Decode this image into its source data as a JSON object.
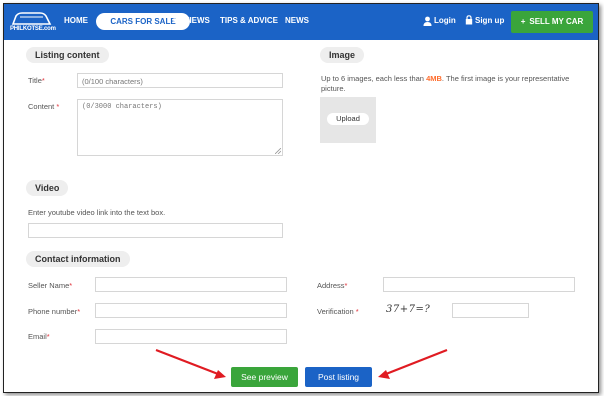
{
  "nav": {
    "logo_text": "PHILKOTSE.com",
    "links": [
      "HOME",
      "CARS FOR SALE",
      "REVIEWS",
      "TIPS & ADVICE",
      "NEWS"
    ],
    "login": "Login",
    "signup": "Sign up",
    "sell": "SELL MY CAR"
  },
  "listing": {
    "heading": "Listing content",
    "title_label": "Title",
    "title_placeholder": "(0/100 characters)",
    "content_label": "Content",
    "content_placeholder": "(0/3000 characters)"
  },
  "image": {
    "heading": "Image",
    "note_prefix": "Up to 6 images, each less than ",
    "note_size": "4MB",
    "note_suffix": ". The first image is your representative picture.",
    "upload_label": "Upload"
  },
  "video": {
    "heading": "Video",
    "note": "Enter youtube video link into the text box."
  },
  "contact": {
    "heading": "Contact information",
    "seller_label": "Seller Name",
    "phone_label": "Phone number",
    "email_label": "Email",
    "address_label": "Address",
    "verification_label": "Verification",
    "captcha_text": "37+7=?"
  },
  "actions": {
    "preview": "See preview",
    "post": "Post listing"
  },
  "colors": {
    "nav_blue": "#1b63c6",
    "green": "#3aa53b",
    "required": "#e0323a",
    "highlight": "#ff6d2d",
    "arrow": "#e01b22"
  }
}
